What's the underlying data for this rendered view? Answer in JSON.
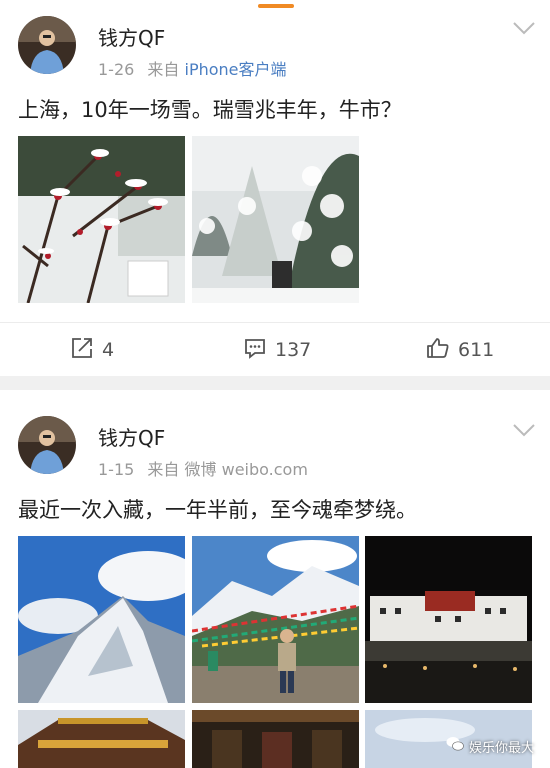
{
  "posts": [
    {
      "username": "钱方QF",
      "date": "1-26",
      "source_prefix": "来自",
      "source": "iPhone客户端",
      "text": "上海，10年一场雪。瑞雪兆丰年，牛市？",
      "images": [
        {
          "icon": "snow-plum-blossom-photo"
        },
        {
          "icon": "snowy-garden-photo"
        }
      ],
      "actions": {
        "repost_count": "4",
        "comment_count": "137",
        "like_count": "611"
      }
    },
    {
      "username": "钱方QF",
      "date": "1-15",
      "source_prefix": "来自",
      "source": "微博 weibo.com",
      "text": "最近一次入藏，一年半前，至今魂牵梦绕。",
      "images": [
        {
          "icon": "snow-mountain-photo"
        },
        {
          "icon": "man-with-prayer-flags-photo"
        },
        {
          "icon": "potala-palace-night-photo"
        },
        {
          "icon": "temple-roof-photo"
        },
        {
          "icon": "temple-interior-photo"
        },
        {
          "icon": "sky-photo"
        }
      ]
    }
  ],
  "watermark": "娱乐你最大",
  "colors": {
    "accent_orange": "#f08a24",
    "link_blue": "#4a7ec2",
    "separator": "#f0f0f0"
  }
}
